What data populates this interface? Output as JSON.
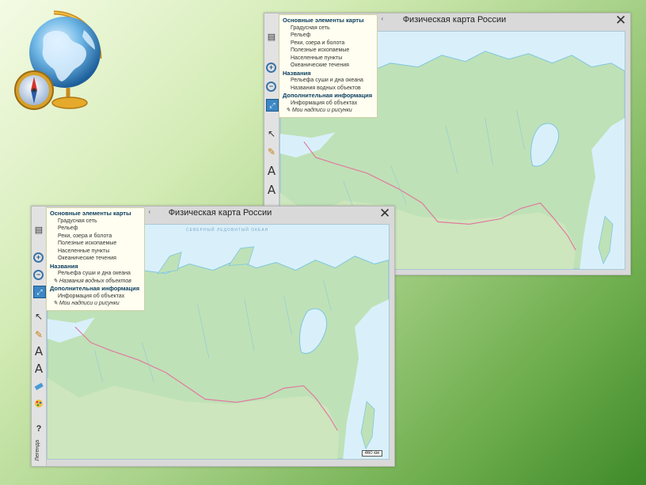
{
  "windows": [
    {
      "title": "Физическая карта России",
      "close_symbol": "✕",
      "collapse_symbol": "‹",
      "layers": {
        "main_header": "Основные элементы карты",
        "main_items": [
          "Градусная сеть",
          "Рельеф",
          "Реки, озера и болота",
          "Полезные ископаемые",
          "Населенные пункты",
          "Океанические течения"
        ],
        "names_header": "Названия",
        "names_items": [
          "Рельефа суши и дна океана",
          "Названия водных объектов"
        ],
        "extra_header": "Дополнительная информация",
        "extra_items": [
          "Информация об объектах",
          "Мои надписи и рисунки"
        ]
      },
      "toolbar": {
        "zoom_in": "+",
        "zoom_out": "−",
        "fit": "⤢",
        "pointer": "↖",
        "pencil": "✎",
        "text": "A",
        "text_move": "A"
      }
    },
    {
      "title": "Физическая карта России",
      "close_symbol": "✕",
      "collapse_symbol": "‹",
      "layers": {
        "main_header": "Основные элементы карты",
        "main_items": [
          "Градусная сеть",
          "Рельеф",
          "Реки, озера и болота",
          "Полезные ископаемые",
          "Населенные пункты",
          "Океанические течения"
        ],
        "names_header": "Названия",
        "names_items": [
          "Рельефа суши и дна океана",
          "Названия водных объектов"
        ],
        "extra_header": "Дополнительная информация",
        "extra_items": [
          "Информация об объектах",
          "Мои надписи и рисунки"
        ]
      },
      "toolbar": {
        "zoom_in": "+",
        "zoom_out": "−",
        "fit": "⤢",
        "pointer": "↖",
        "pencil": "✎",
        "text": "A",
        "text_move": "A",
        "help": "?",
        "legend": "Легенда"
      },
      "ocean_label": "СЕВЕРНЫЙ ЛЕДОВИТЫЙ ОКЕАН",
      "scale": "460 км"
    }
  ],
  "colors": {
    "land": "#bfe1b7",
    "land_alt": "#cde6bd",
    "sea": "#d9f0fb",
    "border": "#e07aa0",
    "coast": "#7fc6df"
  }
}
